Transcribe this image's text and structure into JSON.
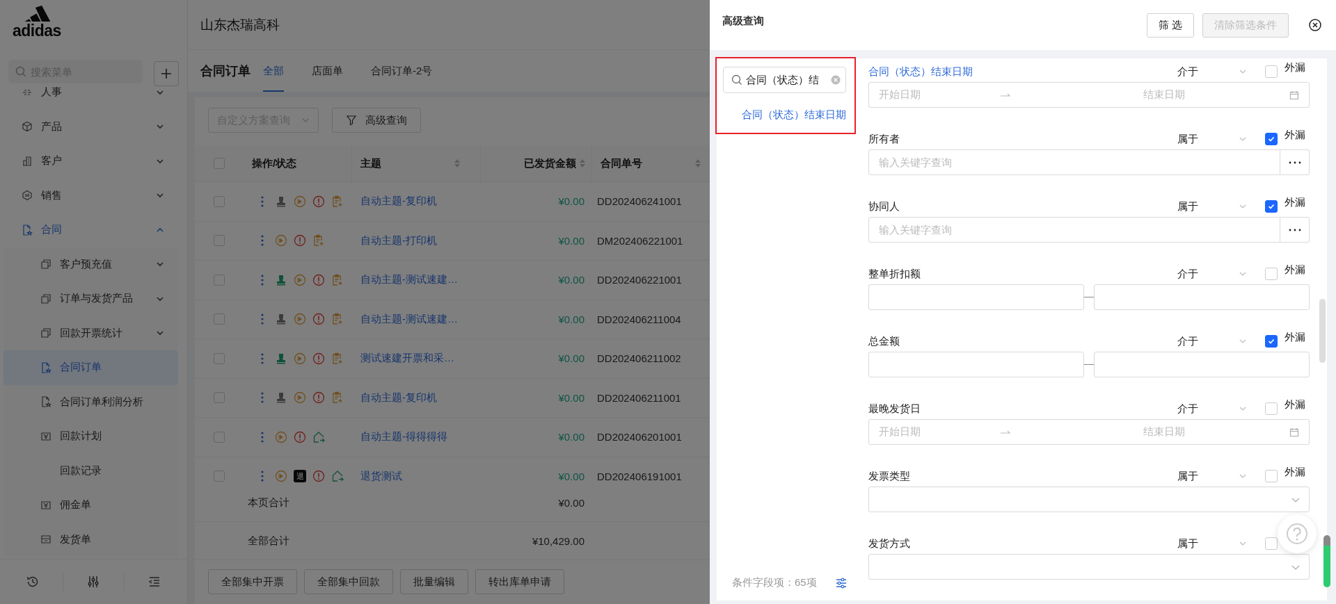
{
  "app": {
    "logo": "adidas",
    "company": "山东杰瑞高科"
  },
  "sidebar": {
    "search": {
      "placeholder": "搜索菜单"
    },
    "items": [
      {
        "label": "人事",
        "kind": "link",
        "expanded": false,
        "selected": false
      },
      {
        "label": "产品",
        "kind": "cube",
        "expanded": false,
        "selected": false
      },
      {
        "label": "客户",
        "kind": "building",
        "expanded": false,
        "selected": false
      },
      {
        "label": "销售",
        "kind": "hexagon",
        "expanded": false,
        "selected": false
      },
      {
        "label": "合同",
        "kind": "doc",
        "expanded": true,
        "selected": false,
        "children": [
          {
            "label": "客户预充值",
            "kind": "stack",
            "expanded": false,
            "selected": false
          },
          {
            "label": "订单与发货产品",
            "kind": "stack",
            "expanded": false,
            "selected": false
          },
          {
            "label": "回款开票统计",
            "kind": "stack",
            "expanded": false,
            "selected": false
          },
          {
            "label": "合同订单",
            "kind": "doc",
            "selected": true
          },
          {
            "label": "合同订单利润分析",
            "kind": "doc",
            "selected": false
          },
          {
            "label": "回款计划",
            "kind": "yen",
            "selected": false
          },
          {
            "label": "回款记录",
            "selected": false
          },
          {
            "label": "佣金单",
            "kind": "yen",
            "selected": false
          },
          {
            "label": "发货单",
            "kind": "box",
            "selected": false
          }
        ]
      }
    ]
  },
  "page": {
    "title": "合同订单",
    "tabs": [
      {
        "label": "全部",
        "selected": true
      },
      {
        "label": "店面单",
        "selected": false
      },
      {
        "label": "合同订单-2号",
        "selected": false
      }
    ]
  },
  "toolbar": {
    "scheme_select": {
      "placeholder": "自定义方案查询"
    },
    "advanced_button": "高级查询"
  },
  "table": {
    "select_all_checked": false,
    "columns": [
      {
        "label": "操作/状态",
        "sortable": false
      },
      {
        "label": "主题",
        "sortable": true
      },
      {
        "label": "已发货金额",
        "sortable": true
      },
      {
        "label": "合同单号",
        "sortable": true
      }
    ],
    "rows": [
      {
        "checked": false,
        "ops": [
          {
            "kind": "owner-grey"
          },
          {
            "kind": "play"
          },
          {
            "kind": "alert"
          },
          {
            "kind": "note"
          }
        ],
        "subject": "自动主题-复印机",
        "amount": "¥0.00",
        "number": "DD202406241001"
      },
      {
        "checked": false,
        "ops": [
          {
            "kind": "play"
          },
          {
            "kind": "alert"
          },
          {
            "kind": "note"
          }
        ],
        "subject": "自动主题-打印机",
        "amount": "¥0.00",
        "number": "DM202406221001"
      },
      {
        "checked": false,
        "ops": [
          {
            "kind": "owner-green"
          },
          {
            "kind": "play"
          },
          {
            "kind": "alert"
          },
          {
            "kind": "note"
          }
        ],
        "subject": "自动主题-测试速建…",
        "amount": "¥0.00",
        "number": "DD202406221001"
      },
      {
        "checked": false,
        "ops": [
          {
            "kind": "owner-grey"
          },
          {
            "kind": "play"
          },
          {
            "kind": "alert"
          },
          {
            "kind": "note"
          }
        ],
        "subject": "自动主题-测试速建…",
        "amount": "¥0.00",
        "number": "DD202406211004"
      },
      {
        "checked": false,
        "ops": [
          {
            "kind": "owner-green"
          },
          {
            "kind": "play"
          },
          {
            "kind": "alert"
          },
          {
            "kind": "note"
          }
        ],
        "subject": "测试速建开票和采…",
        "amount": "¥0.00",
        "number": "DD202406211002"
      },
      {
        "checked": false,
        "ops": [
          {
            "kind": "owner-grey"
          },
          {
            "kind": "play"
          },
          {
            "kind": "alert"
          },
          {
            "kind": "note"
          }
        ],
        "subject": "自动主题-复印机",
        "amount": "¥0.00",
        "number": "DD202406211001"
      },
      {
        "checked": false,
        "ops": [
          {
            "kind": "play"
          },
          {
            "kind": "alert"
          },
          {
            "kind": "share"
          }
        ],
        "subject": "自动主题-得得得得",
        "amount": "¥0.00",
        "number": "DD202406201001"
      },
      {
        "checked": false,
        "ops": [
          {
            "kind": "play"
          },
          {
            "kind": "return",
            "text": "退"
          },
          {
            "kind": "alert"
          },
          {
            "kind": "share"
          }
        ],
        "subject": "退货测试",
        "amount": "¥0.00",
        "number": "DD202406191001"
      }
    ],
    "totals": [
      {
        "label": "本页合计",
        "amount": "¥0.00"
      },
      {
        "label": "全部合计",
        "amount": "¥10,429.00"
      }
    ]
  },
  "bulk_buttons": [
    "全部集中开票",
    "全部集中回款",
    "批量编辑",
    "转出库单申请"
  ],
  "drawer": {
    "title": "高级查询",
    "buttons": [
      {
        "label": "筛 选",
        "disabled": false
      },
      {
        "label": "清除筛选条件",
        "disabled": true
      }
    ],
    "field_search": {
      "value": "合同（状态）结",
      "result": "合同（状态）结束日期"
    },
    "field_count": "条件字段项：65项",
    "fields": [
      {
        "kind": "date-range",
        "label": "合同（状态）结束日期",
        "highlighted": true,
        "operator": "介于",
        "exclude": {
          "label": "外漏",
          "checked": false
        },
        "start_placeholder": "开始日期",
        "end_placeholder": "结束日期"
      },
      {
        "kind": "lookup",
        "label": "所有者",
        "highlighted": false,
        "operator": "属于",
        "exclude": {
          "label": "外漏",
          "checked": true
        },
        "placeholder": "输入关键字查询"
      },
      {
        "kind": "lookup",
        "label": "协同人",
        "highlighted": false,
        "operator": "属于",
        "exclude": {
          "label": "外漏",
          "checked": true
        },
        "placeholder": "输入关键字查询"
      },
      {
        "kind": "number-range",
        "label": "整单折扣额",
        "highlighted": false,
        "operator": "介于",
        "exclude": {
          "label": "外漏",
          "checked": false
        }
      },
      {
        "kind": "number-range",
        "label": "总金额",
        "highlighted": false,
        "operator": "介于",
        "exclude": {
          "label": "外漏",
          "checked": true
        }
      },
      {
        "kind": "date-range",
        "label": "最晚发货日",
        "highlighted": false,
        "operator": "介于",
        "exclude": {
          "label": "外漏",
          "checked": false
        },
        "start_placeholder": "开始日期",
        "end_placeholder": "结束日期"
      },
      {
        "kind": "select",
        "label": "发票类型",
        "highlighted": false,
        "operator": "属于",
        "exclude": {
          "label": "外漏",
          "checked": false
        }
      },
      {
        "kind": "select",
        "label": "发货方式",
        "highlighted": false,
        "operator": "属于",
        "exclude": {
          "checked": false
        }
      }
    ]
  }
}
